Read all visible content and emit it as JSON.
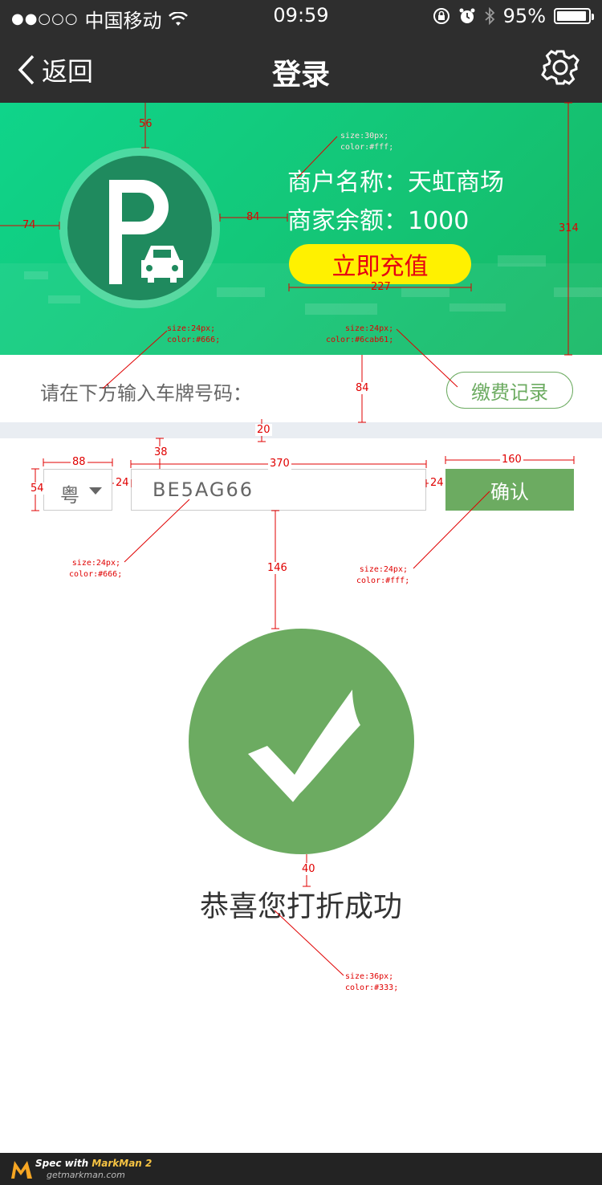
{
  "status_bar": {
    "signal": "●●○○○",
    "carrier": "中国移动",
    "time": "09:59",
    "battery": "95%",
    "battery_level": 0.95
  },
  "nav": {
    "back_label": "返回",
    "title": "登录",
    "back_icon": "chevron-left-icon",
    "settings_icon": "gear-icon"
  },
  "banner": {
    "merchant_name": "商户名称：天虹商场",
    "merchant_balance": "商家余额：1000",
    "recharge_label": "立即充值",
    "logo_icon": "parking-car-icon"
  },
  "prompt": {
    "text": "请在下方输入车牌号码：",
    "records_label": "缴费记录"
  },
  "plate": {
    "province": "粤",
    "number": "BE5AG66",
    "confirm_label": "确认"
  },
  "success": {
    "icon": "checkmark-icon",
    "message": "恭喜您打折成功"
  },
  "annotations": {
    "d56": "56",
    "d74": "74",
    "d84a": "84",
    "d314": "314",
    "d227": "227",
    "d84b": "84",
    "d20": "20",
    "d38": "38",
    "d88": "88",
    "d370": "370",
    "d160": "160",
    "d54": "54",
    "d24a": "24",
    "d24b": "24",
    "d146": "146",
    "d40": "40",
    "note_banner": [
      "size:30px;",
      "color:#fff;"
    ],
    "note_prompt": [
      "size:24px;",
      "color:#666;"
    ],
    "note_records": [
      "size:24px;",
      "color:#6cab61;"
    ],
    "note_input": [
      "size:24px;",
      "color:#666;"
    ],
    "note_confirm": [
      "size:24px;",
      "color:#fff;"
    ],
    "note_success": [
      "size:36px;",
      "color:#333;"
    ]
  },
  "footer": {
    "title_prefix": "Spec with ",
    "title_brand": "MarkMan 2",
    "url": "getmarkman.com"
  },
  "colors": {
    "nav_bg": "#2e2e2e",
    "banner_green": "#13c87a",
    "accent_green": "#6cab61",
    "recharge_yellow": "#fff100",
    "recharge_text": "#e60012",
    "annotation_red": "#e00000"
  }
}
